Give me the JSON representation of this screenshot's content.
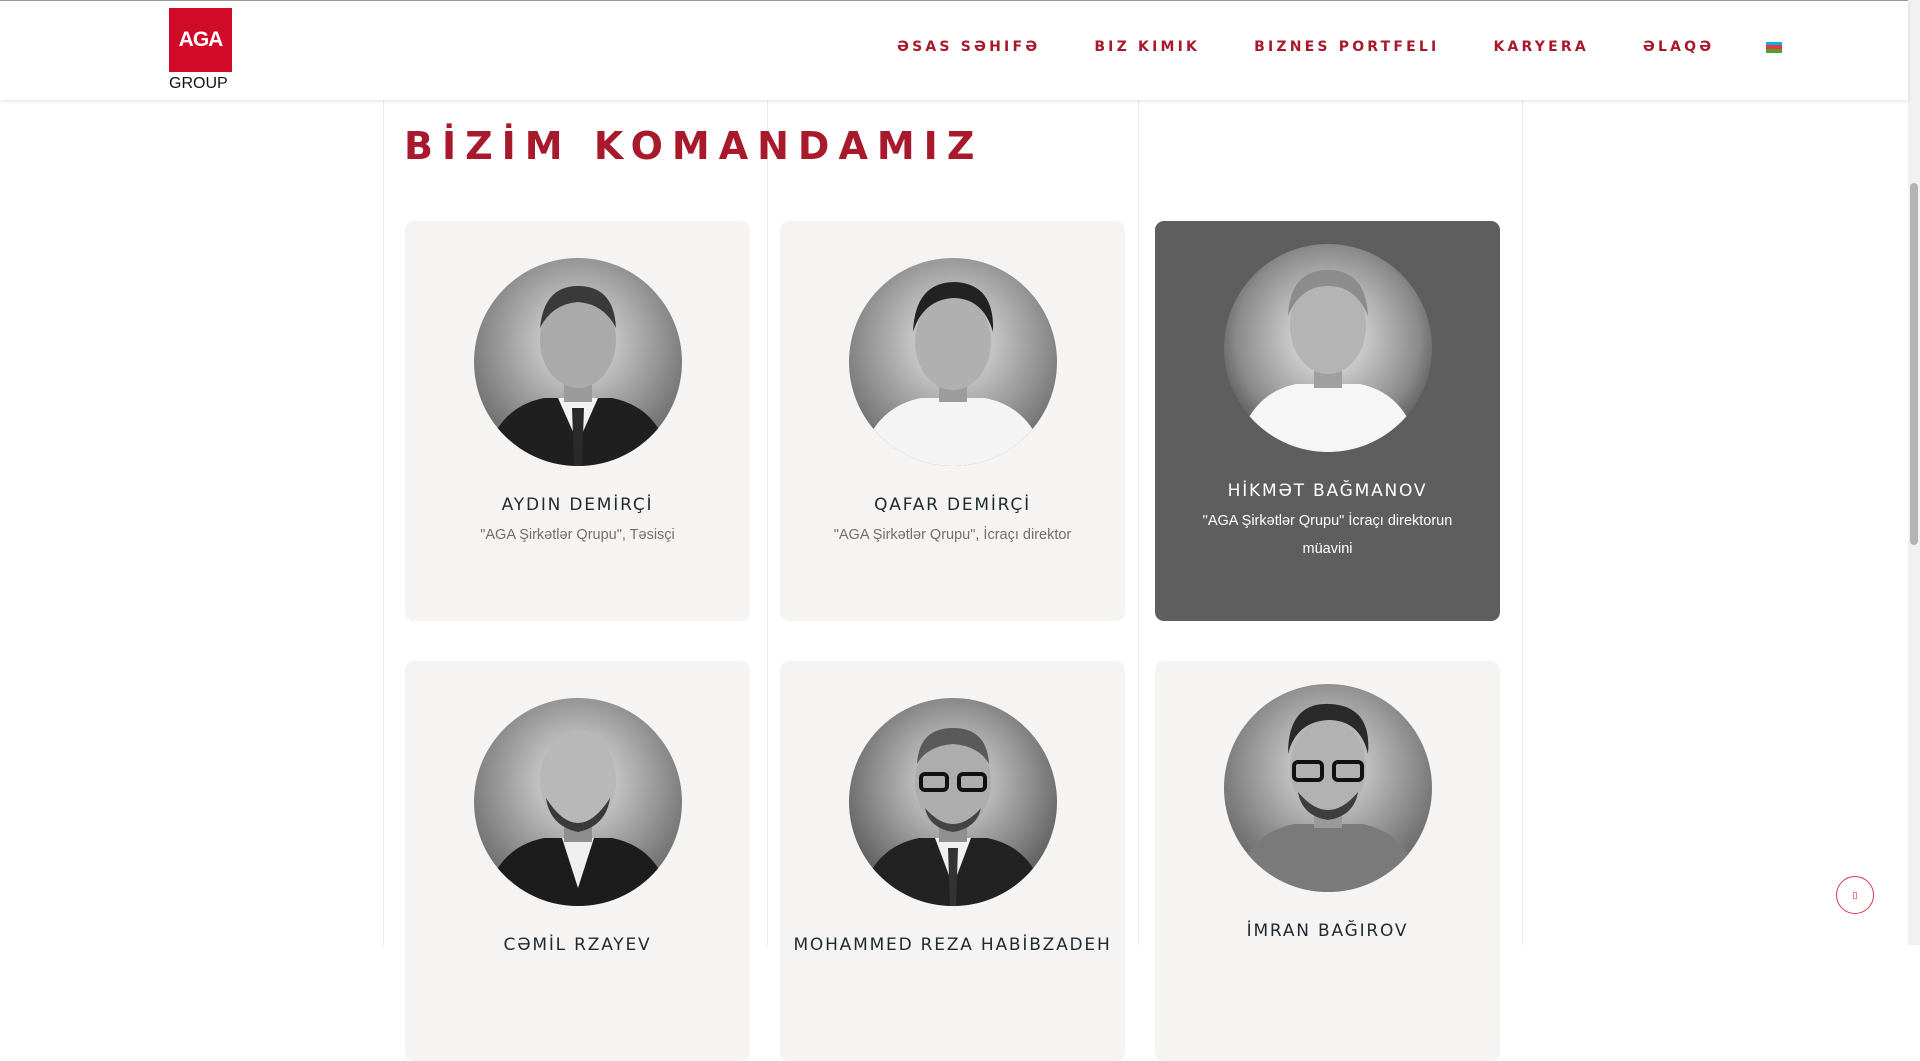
{
  "logo": {
    "mark": "AGA",
    "sub": "GROUP"
  },
  "nav": [
    {
      "label": "əsas səhifə"
    },
    {
      "label": "Biz kimik"
    },
    {
      "label": "Biznes Portfeli"
    },
    {
      "label": "Karyera"
    },
    {
      "label": "Əlaqə"
    }
  ],
  "language_flag": {
    "icon": "azerbaijan-flag-icon",
    "colors": [
      "#00b5e2",
      "#ef3340",
      "#509e2f"
    ]
  },
  "page_title": "BİZİM KOMANDAMIZ",
  "team": [
    {
      "name": "AYDIN DEMİRÇİ",
      "role": "\"AGA Şirkətlər Qrupu\", Təsisçi"
    },
    {
      "name": "QAFAR DEMİRÇİ",
      "role": "\"AGA Şirkətlər Qrupu\", İcraçı direktor"
    },
    {
      "name": "HİKMƏT BAĞMANOV",
      "role": "\"AGA Şirkətlər Qrupu\" İcraçı direktorun müavini"
    },
    {
      "name": "CƏMİL RZAYEV",
      "role": ""
    },
    {
      "name": "MOHAMMED REZA HABİBZADEH",
      "role": ""
    },
    {
      "name": "İMRAN BAĞIROV",
      "role": ""
    }
  ],
  "colors": {
    "accent": "#a8192b",
    "brand": "#d10a28",
    "card_bg": "#f5f4f2",
    "card_active_bg": "#5e5e5e"
  },
  "scroll_top_icon": "arrow-up-icon"
}
